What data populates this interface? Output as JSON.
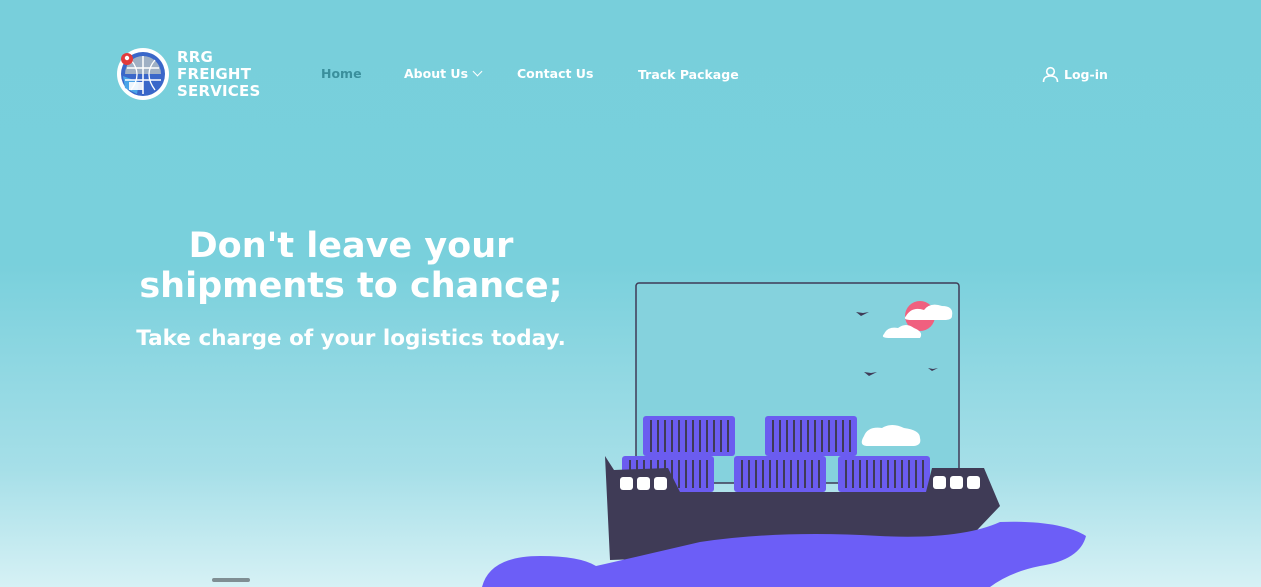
{
  "brand": {
    "name_lines": [
      "RRG",
      "FREIGHT",
      "SERVICES"
    ],
    "logo_ring_text": "RRG FREIGHT SERVICES"
  },
  "nav": {
    "items": [
      {
        "label": "Home",
        "active": true
      },
      {
        "label": "About Us",
        "has_dropdown": true
      },
      {
        "label": "Contact Us"
      },
      {
        "label": "Track Package"
      }
    ]
  },
  "auth": {
    "login_label": "Log-in",
    "icon": "user-icon"
  },
  "hero": {
    "title_line1": "Don't leave your",
    "title_line2": "shipments to chance;",
    "subtitle": "Take charge of your logistics today."
  },
  "colors": {
    "background": "#78cfdb",
    "nav_active": "#3a8f9c",
    "container": "#6b5cf0",
    "hull": "#3f3b56",
    "water": "#6c5ef7",
    "sun": "#f0607f"
  }
}
